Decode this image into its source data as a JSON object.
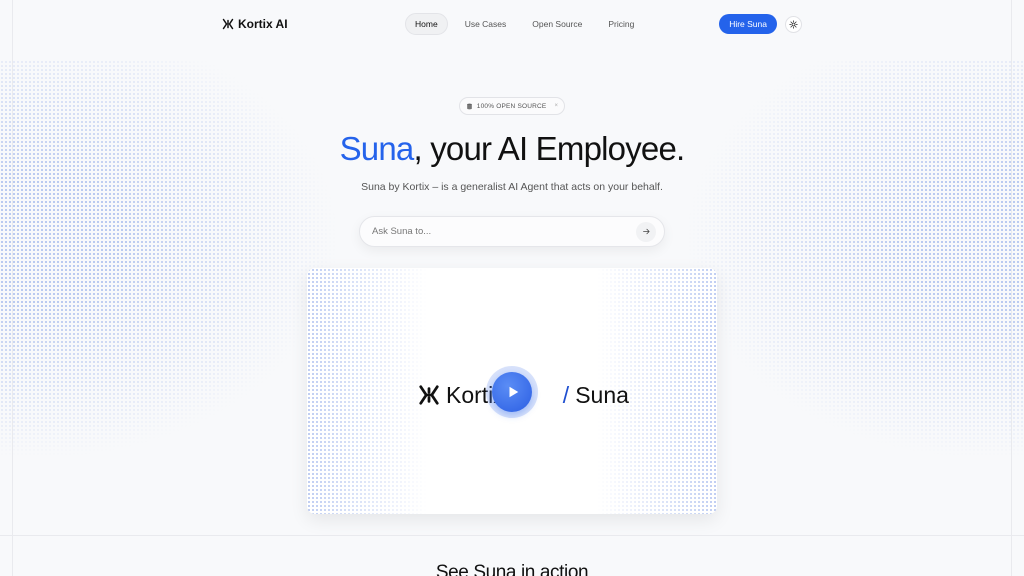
{
  "nav": {
    "logo_text": "Kortix AI",
    "links": [
      {
        "label": "Home",
        "active": true
      },
      {
        "label": "Use Cases",
        "active": false
      },
      {
        "label": "Open Source",
        "active": false
      },
      {
        "label": "Pricing",
        "active": false
      }
    ],
    "cta_label": "Hire Suna",
    "theme_icon": "sun-icon"
  },
  "badge": {
    "label": "100% OPEN SOURCE",
    "icon": "database-icon",
    "trailing": "×"
  },
  "hero": {
    "headline_accent": "Suna",
    "headline_rest": ", your AI Employee.",
    "subline": "Suna by Kortix – is a generalist AI Agent that acts on your behalf."
  },
  "ask": {
    "placeholder": "Ask Suna to...",
    "value": "",
    "send_icon": "arrow-right-icon"
  },
  "video": {
    "brand_left": "Kortix",
    "separator": "/",
    "brand_right": "Suna",
    "play_icon": "play-icon"
  },
  "section": {
    "title": "See Suna in action"
  },
  "colors": {
    "accent": "#2563eb",
    "background": "#f8f9fb",
    "text": "#111111"
  }
}
